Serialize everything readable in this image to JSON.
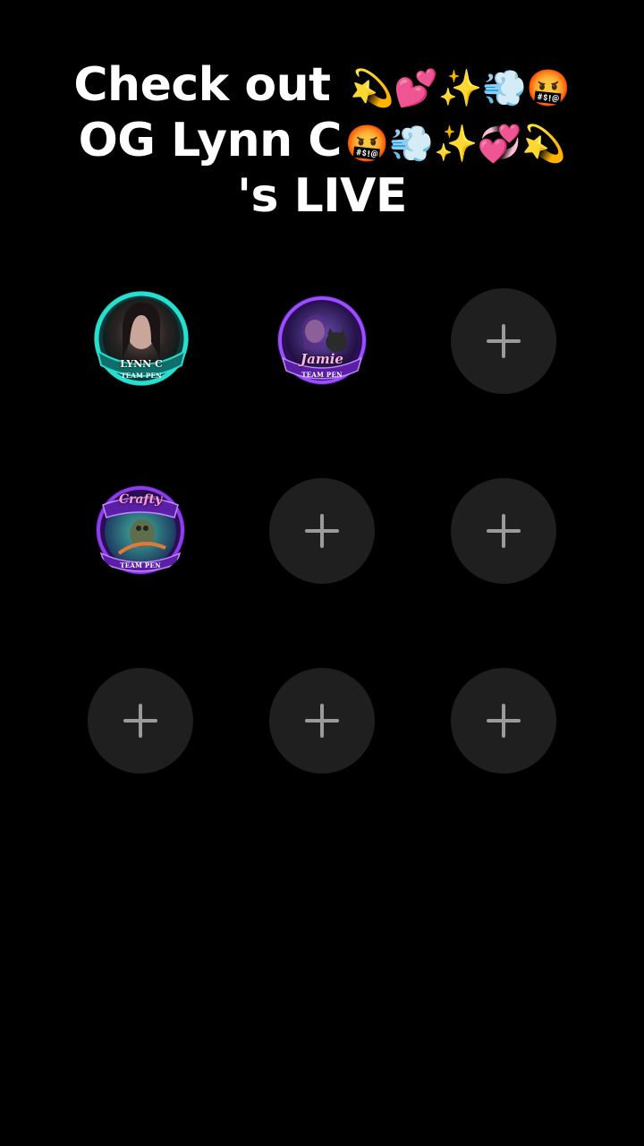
{
  "header": {
    "line1_text": "Check out",
    "line1_emoji": "💫💕✨💨🤬",
    "line2_text": "OG Lynn C",
    "line2_emoji": "🤬💨✨💞💫",
    "line3_text": "'s LIVE"
  },
  "slots": [
    {
      "type": "avatar",
      "name": "LYNN C",
      "team": "TEAM PEN",
      "frame_color": "#1fd1c1"
    },
    {
      "type": "avatar",
      "name": "Jamie",
      "team": "TEAM PEN",
      "frame_color": "#8a3cf0"
    },
    {
      "type": "add",
      "icon": "plus-icon"
    },
    {
      "type": "avatar",
      "name": "Crafty",
      "team": "TEAM PEN",
      "frame_color": "#7b34e0"
    },
    {
      "type": "add",
      "icon": "plus-icon"
    },
    {
      "type": "add",
      "icon": "plus-icon"
    },
    {
      "type": "add",
      "icon": "plus-icon"
    },
    {
      "type": "add",
      "icon": "plus-icon"
    },
    {
      "type": "add",
      "icon": "plus-icon"
    }
  ]
}
